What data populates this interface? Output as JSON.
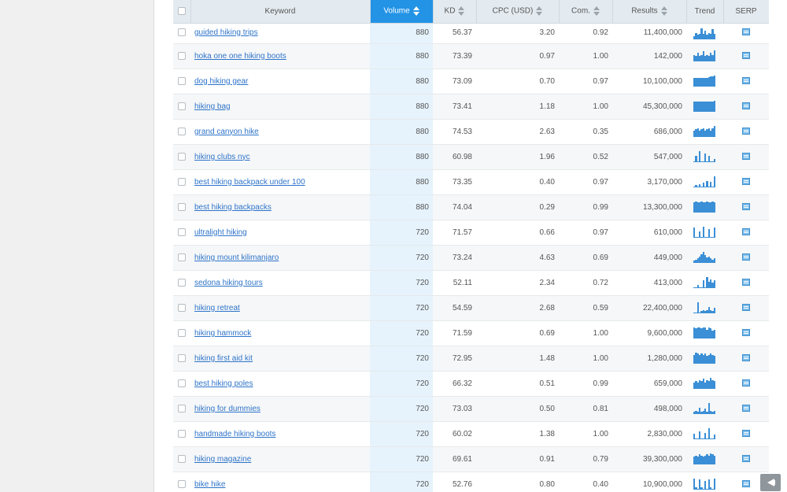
{
  "header": {
    "keyword": "Keyword",
    "volume": "Volume",
    "kd": "KD",
    "cpc": "CPC (USD)",
    "com": "Com.",
    "results": "Results",
    "trend": "Trend",
    "serp": "SERP"
  },
  "colors": {
    "accent": "#2393e6",
    "link": "#2e74c9",
    "trend_bar": "#3b8fd6",
    "volume_column": "#e6f3fd"
  },
  "rows": [
    {
      "keyword": "guided hiking trips",
      "volume": "880",
      "kd": "56.37",
      "cpc": "3.20",
      "com": "0.92",
      "results": "11,400,000",
      "trend": [
        0.3,
        0.6,
        0.4,
        0.5,
        1.0,
        0.5,
        0.8,
        0.4,
        0.6,
        0.5,
        0.9,
        0.5
      ]
    },
    {
      "keyword": "hoka one one hiking boots",
      "volume": "880",
      "kd": "73.39",
      "cpc": "0.97",
      "com": "1.00",
      "results": "142,000",
      "trend": [
        0.6,
        0.5,
        0.8,
        0.5,
        0.6,
        0.9,
        0.5,
        0.6,
        0.5,
        0.8,
        0.6,
        1.0
      ]
    },
    {
      "keyword": "dog hiking gear",
      "volume": "880",
      "kd": "73.09",
      "cpc": "0.70",
      "com": "0.97",
      "results": "10,100,000",
      "trend": [
        0.8,
        0.8,
        0.8,
        0.8,
        0.8,
        0.8,
        0.8,
        0.8,
        0.85,
        0.9,
        0.95,
        1.0
      ]
    },
    {
      "keyword": "hiking bag",
      "volume": "880",
      "kd": "73.41",
      "cpc": "1.18",
      "com": "1.00",
      "results": "45,300,000",
      "trend": [
        0.9,
        0.9,
        0.9,
        0.9,
        0.95,
        0.9,
        0.9,
        0.9,
        0.9,
        0.95,
        0.9,
        1.0
      ]
    },
    {
      "keyword": "grand canyon hike",
      "volume": "880",
      "kd": "74.53",
      "cpc": "2.63",
      "com": "0.35",
      "results": "686,000",
      "trend": [
        0.6,
        0.7,
        0.8,
        0.6,
        0.7,
        0.8,
        0.6,
        0.7,
        0.8,
        0.6,
        0.8,
        1.0
      ]
    },
    {
      "keyword": "hiking clubs nyc",
      "volume": "880",
      "kd": "60.98",
      "cpc": "1.96",
      "com": "0.52",
      "results": "547,000",
      "trend": [
        0.1,
        0.6,
        0.1,
        1.0,
        0.1,
        0.1,
        0.8,
        0.1,
        0.6,
        0.1,
        0.1,
        0.3
      ]
    },
    {
      "keyword": "best hiking backpack under 100",
      "volume": "880",
      "kd": "73.35",
      "cpc": "0.40",
      "com": "0.97",
      "results": "3,170,000",
      "trend": [
        0.1,
        0.2,
        0.1,
        0.3,
        0.1,
        0.4,
        0.1,
        0.6,
        0.1,
        0.5,
        0.1,
        1.0
      ]
    },
    {
      "keyword": "best hiking backpacks",
      "volume": "880",
      "kd": "74.04",
      "cpc": "0.29",
      "com": "0.99",
      "results": "13,300,000",
      "trend": [
        0.9,
        1.0,
        0.9,
        0.9,
        1.0,
        0.9,
        0.9,
        1.0,
        0.9,
        0.9,
        1.0,
        0.9
      ]
    },
    {
      "keyword": "ultralight hiking",
      "volume": "720",
      "kd": "71.57",
      "cpc": "0.66",
      "com": "0.97",
      "results": "610,000",
      "trend": [
        0.9,
        0.1,
        0.1,
        0.6,
        0.1,
        1.0,
        0.1,
        0.1,
        0.8,
        0.1,
        0.1,
        0.9
      ]
    },
    {
      "keyword": "hiking mount kilimanjaro",
      "volume": "720",
      "kd": "73.24",
      "cpc": "4.63",
      "com": "0.69",
      "results": "449,000",
      "trend": [
        0.2,
        0.3,
        0.4,
        0.6,
        0.8,
        1.0,
        0.7,
        0.5,
        0.6,
        0.4,
        0.3,
        0.4
      ]
    },
    {
      "keyword": "sedona hiking tours",
      "volume": "720",
      "kd": "52.11",
      "cpc": "2.34",
      "com": "0.72",
      "results": "413,000",
      "trend": [
        0.1,
        0.1,
        0.3,
        0.1,
        0.1,
        0.7,
        0.1,
        1.0,
        0.6,
        0.8,
        0.5,
        0.7
      ]
    },
    {
      "keyword": "hiking retreat",
      "volume": "720",
      "kd": "54.59",
      "cpc": "2.68",
      "com": "0.59",
      "results": "22,400,000",
      "trend": [
        0.1,
        0.1,
        1.0,
        0.1,
        0.2,
        0.3,
        0.2,
        0.3,
        0.6,
        0.3,
        0.2,
        0.5
      ]
    },
    {
      "keyword": "hiking hammock",
      "volume": "720",
      "kd": "71.59",
      "cpc": "0.69",
      "com": "1.00",
      "results": "9,600,000",
      "trend": [
        1.0,
        0.9,
        1.0,
        1.0,
        0.9,
        1.0,
        1.0,
        0.8,
        1.0,
        0.9,
        0.7,
        0.8
      ]
    },
    {
      "keyword": "hiking first aid kit",
      "volume": "720",
      "kd": "72.95",
      "cpc": "1.48",
      "com": "1.00",
      "results": "1,280,000",
      "trend": [
        0.8,
        1.0,
        0.9,
        0.8,
        0.9,
        0.8,
        0.9,
        0.7,
        0.8,
        0.9,
        0.8,
        0.7
      ]
    },
    {
      "keyword": "best hiking poles",
      "volume": "720",
      "kd": "66.32",
      "cpc": "0.51",
      "com": "0.99",
      "results": "659,000",
      "trend": [
        0.6,
        0.7,
        0.6,
        0.8,
        0.7,
        0.9,
        0.6,
        0.8,
        0.7,
        1.0,
        0.8,
        0.7
      ]
    },
    {
      "keyword": "hiking for dummies",
      "volume": "720",
      "kd": "73.03",
      "cpc": "0.50",
      "com": "0.81",
      "results": "498,000",
      "trend": [
        0.2,
        0.3,
        0.2,
        0.6,
        0.2,
        0.3,
        0.5,
        0.2,
        1.0,
        0.3,
        0.2,
        0.3
      ]
    },
    {
      "keyword": "handmade hiking boots",
      "volume": "720",
      "kd": "60.02",
      "cpc": "1.38",
      "com": "1.00",
      "results": "2,830,000",
      "trend": [
        0.5,
        0.1,
        0.1,
        0.7,
        0.1,
        0.1,
        0.6,
        0.1,
        1.0,
        0.1,
        0.1,
        0.4
      ]
    },
    {
      "keyword": "hiking magazine",
      "volume": "720",
      "kd": "69.61",
      "cpc": "0.91",
      "com": "0.79",
      "results": "39,300,000",
      "trend": [
        0.7,
        0.8,
        0.7,
        0.9,
        0.8,
        0.7,
        0.8,
        0.9,
        0.8,
        1.0,
        0.9,
        0.8
      ]
    },
    {
      "keyword": "bike hike",
      "volume": "720",
      "kd": "52.76",
      "cpc": "0.80",
      "com": "0.40",
      "results": "10,900,000",
      "trend": [
        1.0,
        0.2,
        0.1,
        0.9,
        0.2,
        0.1,
        0.8,
        0.1,
        0.9,
        0.2,
        0.1,
        1.0
      ]
    }
  ]
}
